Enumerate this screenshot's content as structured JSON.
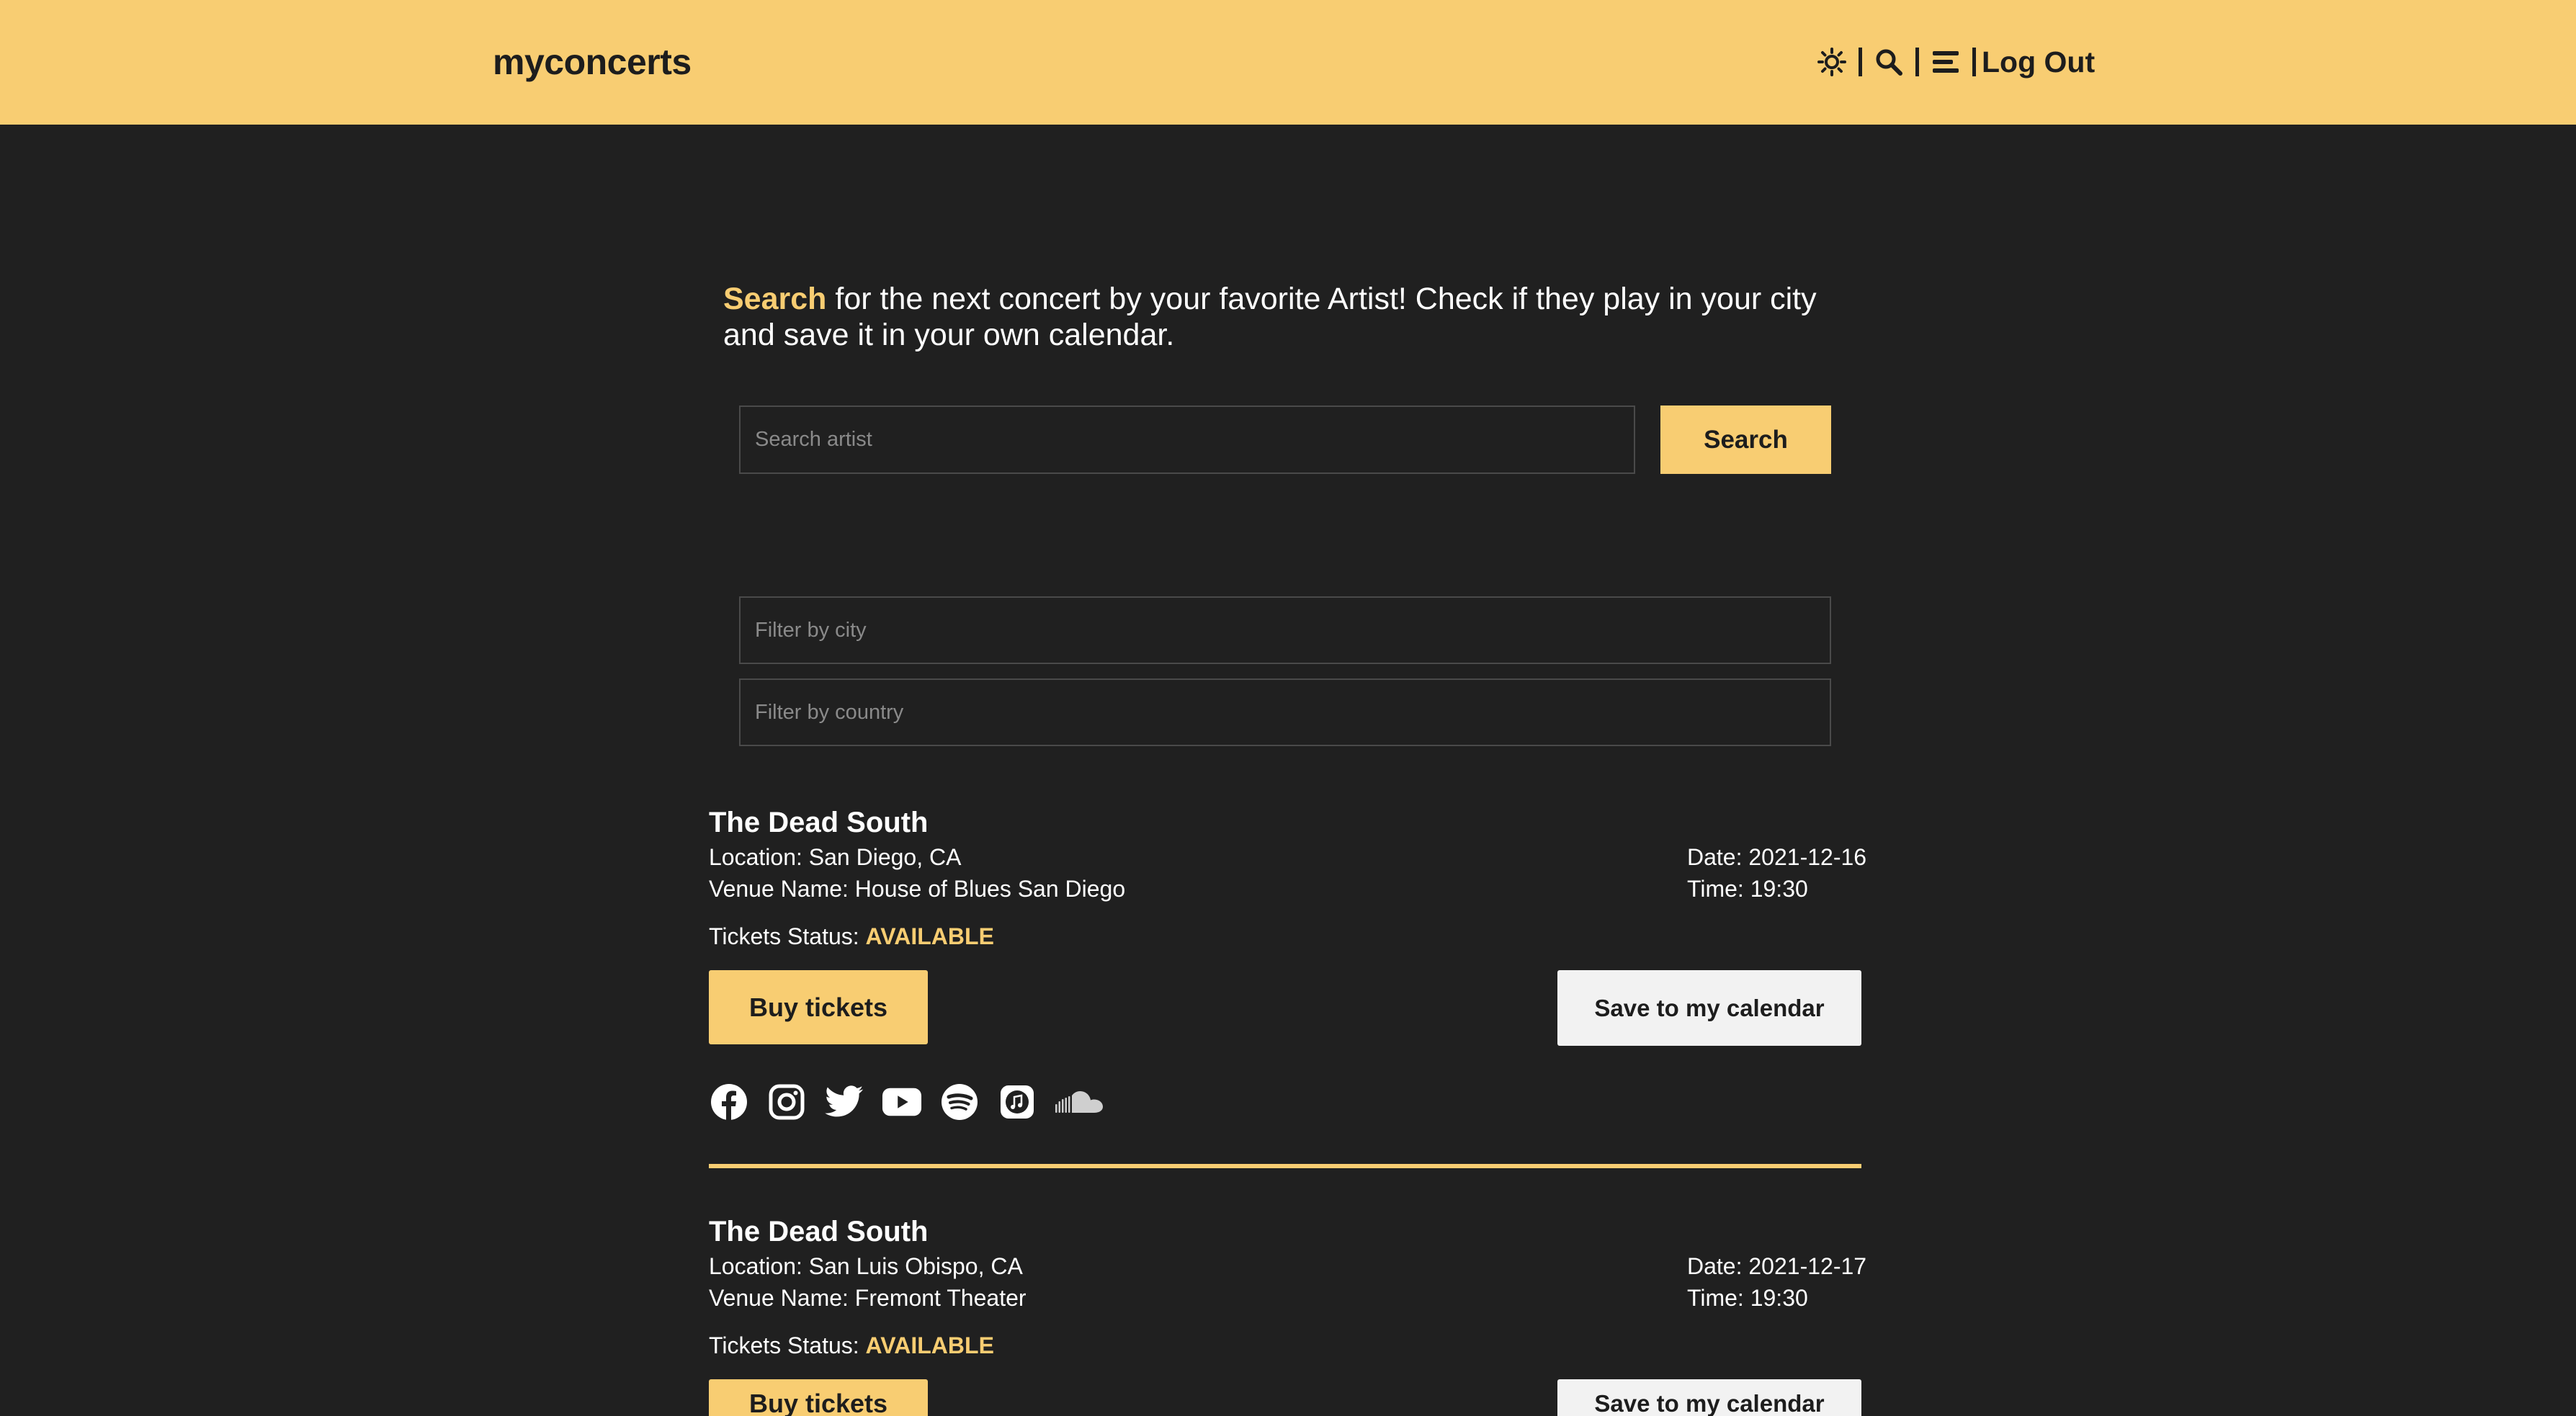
{
  "header": {
    "brand": "myconcerts",
    "icons": [
      "sun-icon",
      "search-icon",
      "menu-icon"
    ],
    "separator": "|",
    "logout_label": "Log Out",
    "colors": {
      "header_bg": "#f8cd72",
      "page_bg": "#202020",
      "accent": "#f8cd72"
    }
  },
  "intro": {
    "highlight": "Search",
    "text": " for the next concert by your favorite Artist! Check if they play in your city and save it in your own calendar."
  },
  "search": {
    "placeholder": "Search artist",
    "value": "",
    "button_label": "Search"
  },
  "filters": {
    "city_placeholder": "Filter by city",
    "country_placeholder": "Filter by country"
  },
  "concerts": [
    {
      "artist": "The Dead South",
      "location_label": "Location: ",
      "location": "San Diego, CA",
      "venue_label": "Venue Name: ",
      "venue": "House of Blues San Diego",
      "date_label": "Date: ",
      "date": "2021-12-16",
      "time_label": "Time: ",
      "time": "19:30",
      "status_label": "Tickets Status: ",
      "status": "AVAILABLE",
      "buy_label": "Buy tickets",
      "save_label": "Save to my calendar",
      "socials": [
        "facebook-icon",
        "instagram-icon",
        "twitter-icon",
        "youtube-icon",
        "spotify-icon",
        "itunes-icon",
        "soundcloud-icon"
      ]
    },
    {
      "artist": "The Dead South",
      "location_label": "Location: ",
      "location": "San Luis Obispo, CA",
      "venue_label": "Venue Name: ",
      "venue": "Fremont Theater",
      "date_label": "Date: ",
      "date": "2021-12-17",
      "time_label": "Time: ",
      "time": "19:30",
      "status_label": "Tickets Status: ",
      "status": "AVAILABLE",
      "buy_label": "Buy tickets",
      "save_label": "Save to my calendar"
    }
  ]
}
